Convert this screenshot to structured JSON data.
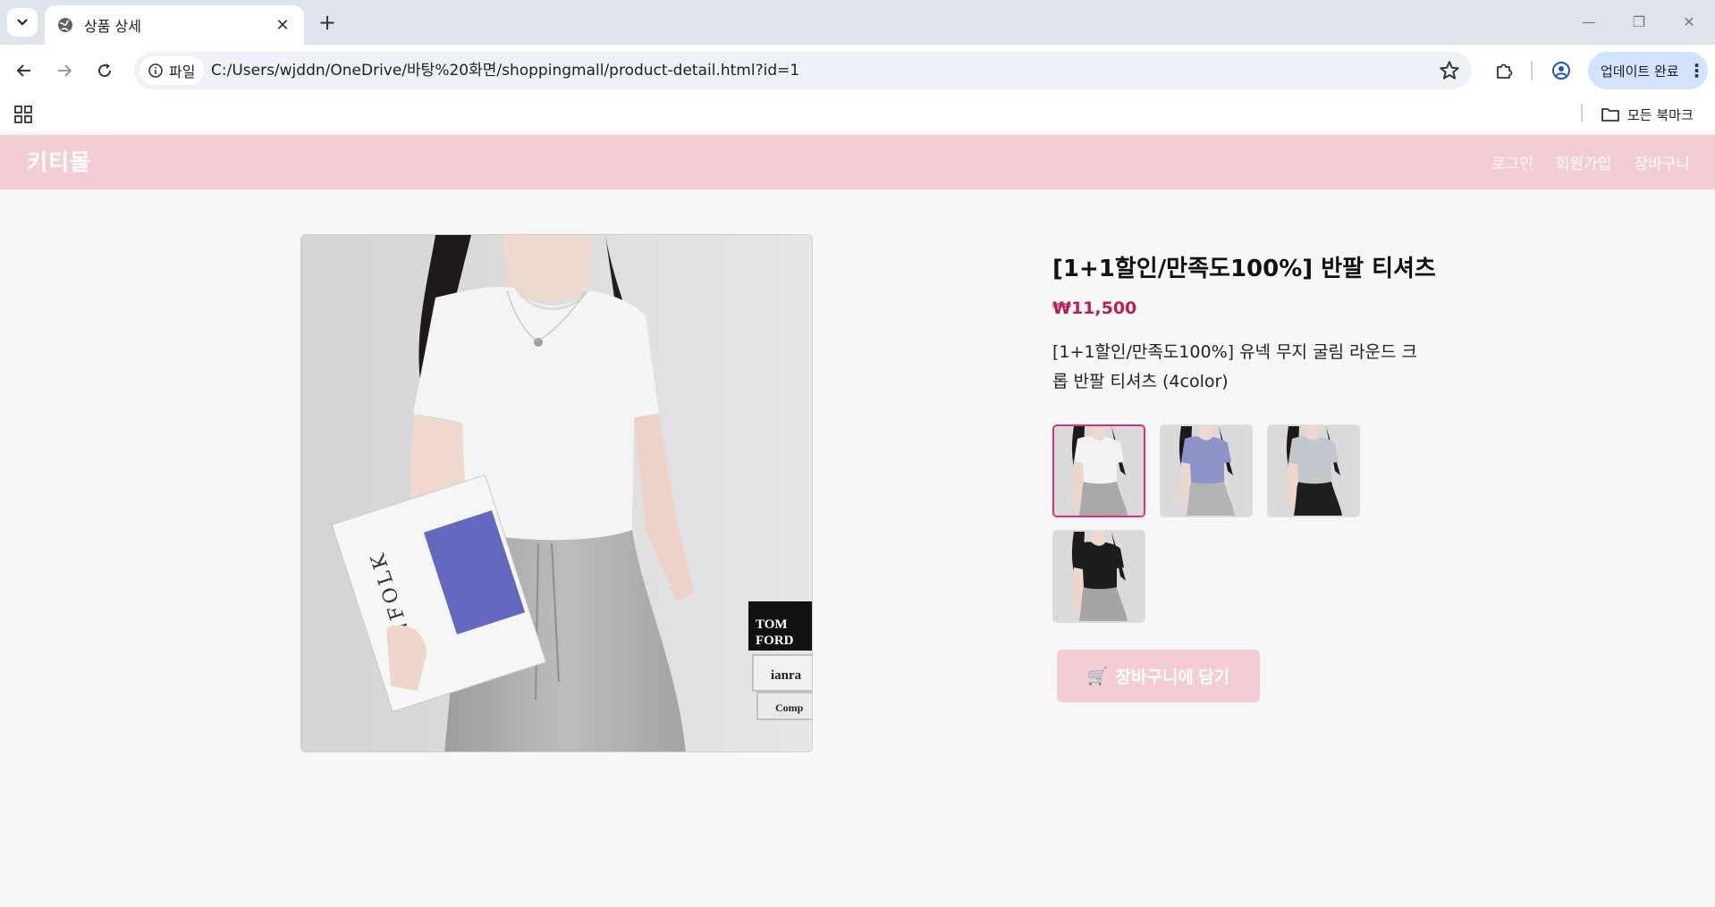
{
  "browser": {
    "tab_title": "상품 상세",
    "site_chip_label": "파일",
    "url": "C:/Users/wjddn/OneDrive/바탕%20화면/shoppingmall/product-detail.html?id=1",
    "update_button": "업데이트 완료",
    "all_bookmarks": "모든 북마크"
  },
  "site": {
    "logo": "키티몰",
    "nav": [
      "로그인",
      "회원가입",
      "장바구니"
    ]
  },
  "product": {
    "title": "[1+1할인/만족도100%] 반팔 티셔츠",
    "price": "₩11,500",
    "description": "[1+1할인/만족도100%] 유넥 무지 굴림 라운드 크롭 반팔 티셔츠 (4color)",
    "cart_button": "장바구니에 담기",
    "main_image": {
      "book_text": "KINFOLK",
      "side_book_lines": [
        "TOM",
        "FORD",
        "ianra",
        "Comp"
      ]
    },
    "thumbnails": [
      {
        "color": "white",
        "tee": "#f2f2f2",
        "pants": "#a9a9a9",
        "selected": true
      },
      {
        "color": "blue",
        "tee": "#8d93c9",
        "pants": "#b3b3b3",
        "selected": false
      },
      {
        "color": "gray",
        "tee": "#c3c6cc",
        "pants": "#1e1e1e",
        "selected": false
      },
      {
        "color": "black",
        "tee": "#1c1c1c",
        "pants": "#a5a5a5",
        "selected": false
      }
    ]
  },
  "colors": {
    "header_bg": "#f4cdd4",
    "price": "#b81e5b",
    "selected_border": "#e0307d"
  }
}
